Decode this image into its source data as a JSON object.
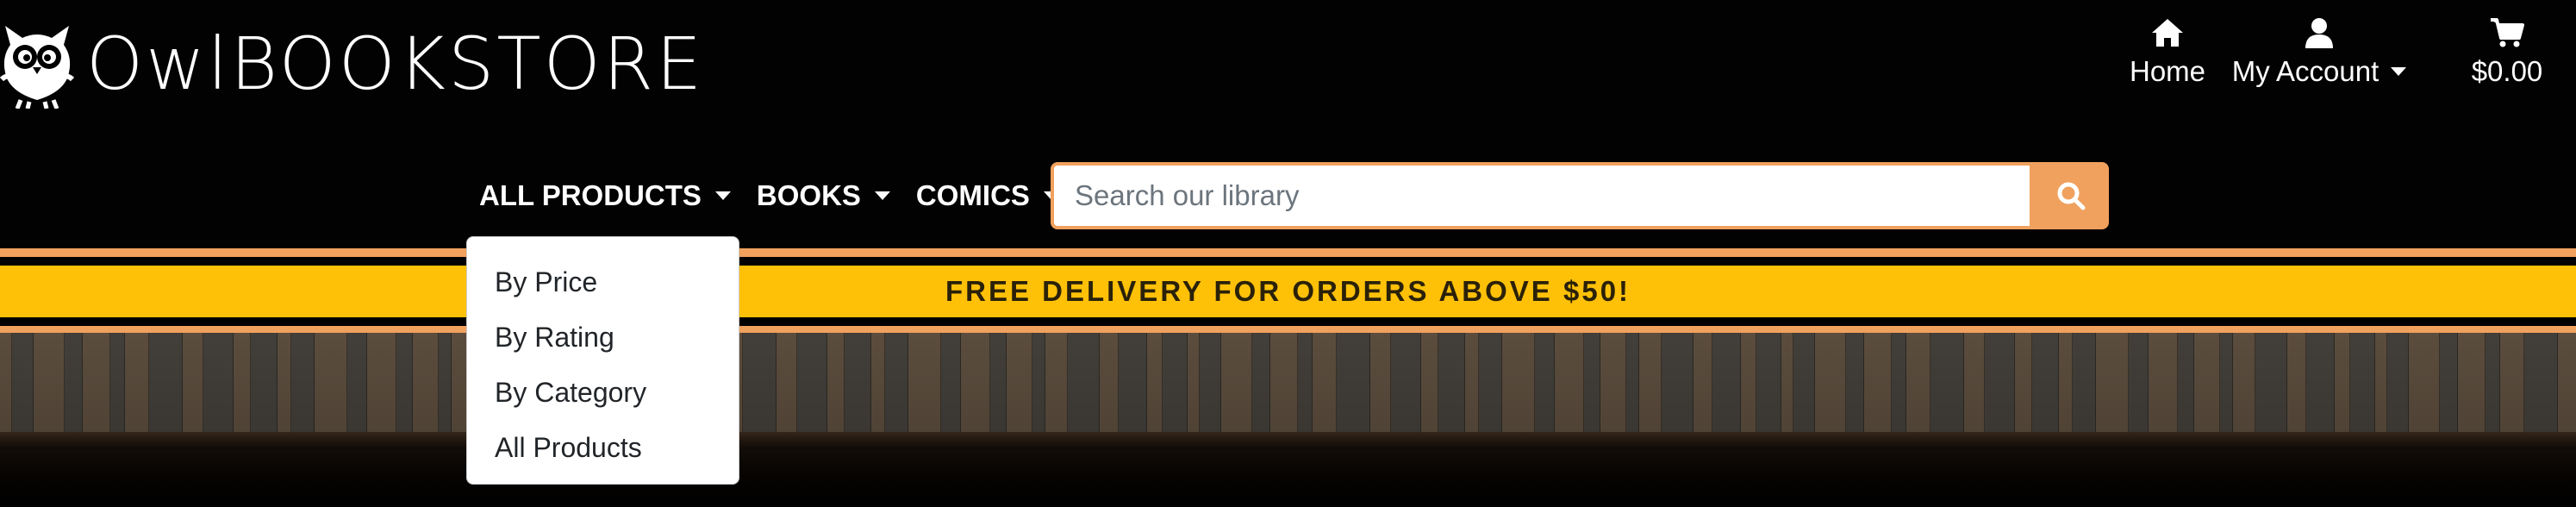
{
  "brand": {
    "name": "OwlBOOKSTORE",
    "logo_icon": "owl-icon"
  },
  "topnav": {
    "home": {
      "label": "Home",
      "icon": "home-icon"
    },
    "account": {
      "label": "My Account",
      "icon": "user-icon"
    },
    "cart": {
      "label": "$0.00",
      "icon": "cart-icon"
    }
  },
  "mainnav": {
    "items": [
      {
        "label": "ALL PRODUCTS"
      },
      {
        "label": "BOOKS"
      },
      {
        "label": "COMICS"
      }
    ]
  },
  "search": {
    "placeholder": "Search our library",
    "button_icon": "search-icon"
  },
  "banner": {
    "text": "FREE DELIVERY FOR ORDERS ABOVE $50!"
  },
  "dropdown": {
    "open_for": "ALL PRODUCTS",
    "items": [
      {
        "label": "By Price"
      },
      {
        "label": "By Rating"
      },
      {
        "label": "By Category"
      },
      {
        "label": "All Products"
      }
    ]
  },
  "colors": {
    "accent": "#f0a15e",
    "banner": "#ffc107",
    "background": "#030202"
  }
}
